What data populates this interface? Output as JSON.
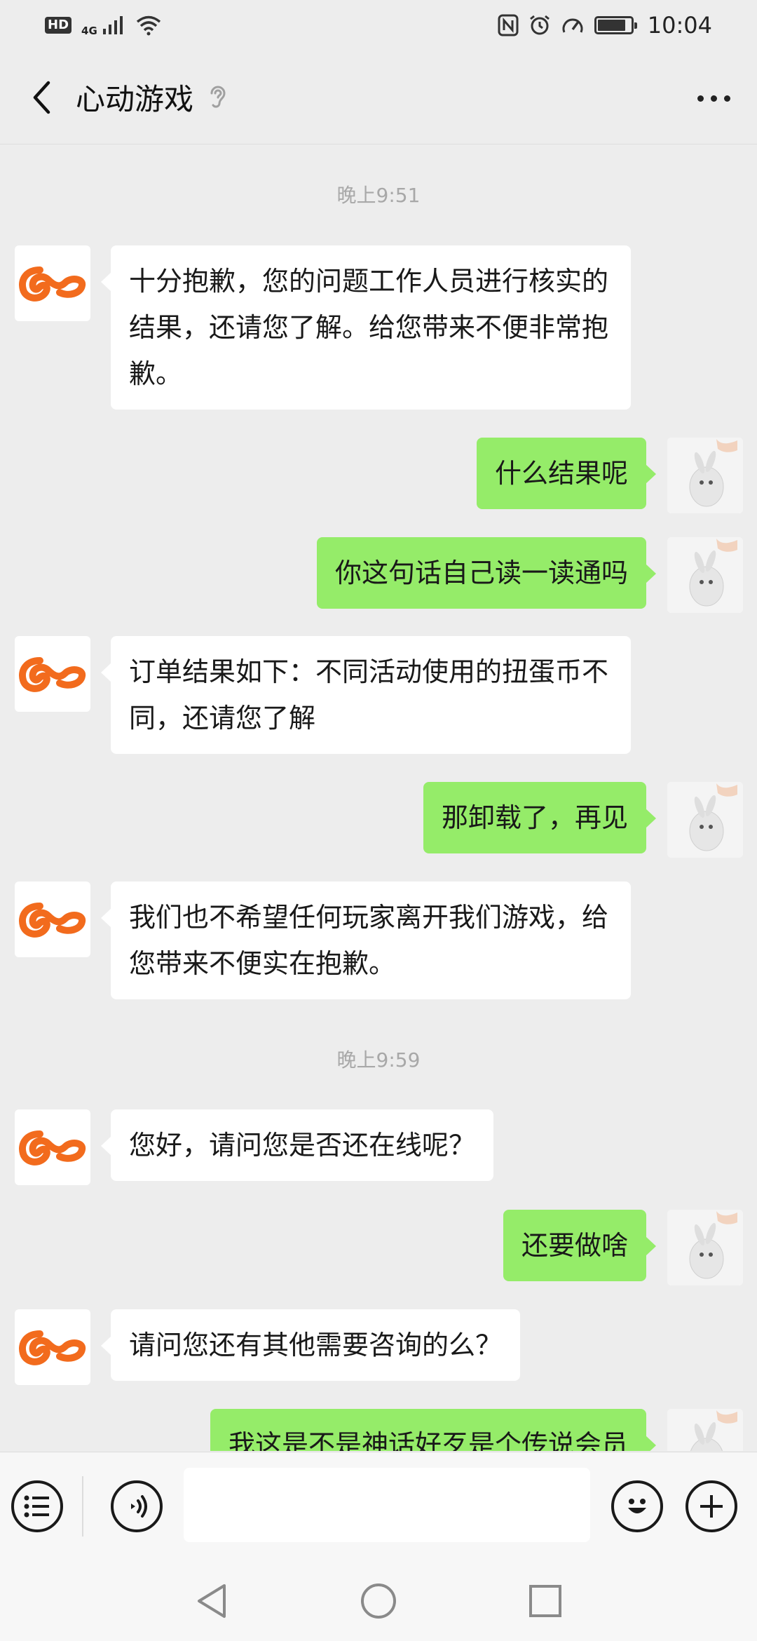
{
  "status_bar": {
    "hd": "HD",
    "network": "4G",
    "time": "10:04"
  },
  "header": {
    "title": "心动游戏"
  },
  "colors": {
    "background": "#ededed",
    "bubble_self": "#95ec69",
    "bubble_other": "#ffffff",
    "brand_orange": "#f26b1d"
  },
  "messages": [
    {
      "type": "time",
      "text": "晚上9:51"
    },
    {
      "type": "msg",
      "side": "left",
      "text": "十分抱歉，您的问题工作人员进行核实的结果，还请您了解。给您带来不便非常抱歉。"
    },
    {
      "type": "msg",
      "side": "right",
      "text": "什么结果呢"
    },
    {
      "type": "msg",
      "side": "right",
      "text": "你这句话自己读一读通吗"
    },
    {
      "type": "msg",
      "side": "left",
      "text": "订单结果如下：不同活动使用的扭蛋币不同，还请您了解"
    },
    {
      "type": "msg",
      "side": "right",
      "text": "那卸载了，再见"
    },
    {
      "type": "msg",
      "side": "left",
      "text": "我们也不希望任何玩家离开我们游戏，给您带来不便实在抱歉。"
    },
    {
      "type": "time",
      "text": "晚上9:59"
    },
    {
      "type": "msg",
      "side": "left",
      "text": "您好，请问您是否还在线呢？"
    },
    {
      "type": "msg",
      "side": "right",
      "text": "还要做啥"
    },
    {
      "type": "msg",
      "side": "left",
      "text": "请问您还有其他需要咨询的么？"
    },
    {
      "type": "msg",
      "side": "right",
      "text": "我这是不是神话好歹是个传说会员"
    }
  ],
  "input_bar": {
    "value": ""
  },
  "icons": {
    "back": "back-arrow-icon",
    "ear": "ear-icon",
    "more": "more-icon",
    "menu": "list-menu-icon",
    "voice": "voice-icon",
    "emoji": "emoji-icon",
    "plus": "plus-icon"
  }
}
